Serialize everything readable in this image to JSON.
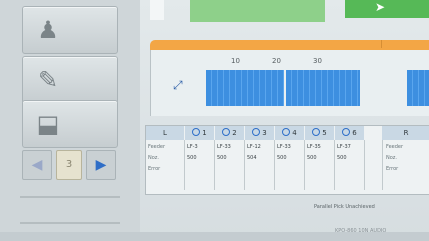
{
  "table": {
    "headers": [
      "L",
      "1",
      "2",
      "3",
      "4",
      "5",
      "6",
      "R"
    ],
    "row_labels": [
      "Feeder",
      "Noz.",
      "Error"
    ],
    "right_row_labels": [
      "Feeder",
      "Noz.",
      "Error"
    ],
    "feeder": [
      "LF-3",
      "LF-33",
      "LF-12",
      "LF-33",
      "LF-35",
      "LF-37"
    ],
    "nozzle": [
      "500",
      "500",
      "504",
      "500",
      "500",
      "500"
    ]
  },
  "scale": {
    "ticks": [
      "10",
      "20",
      "30"
    ]
  },
  "nav": {
    "left_arrow": "◀",
    "right_arrow": "▶",
    "slot": "3"
  },
  "rail": {
    "btn1_glyph": "♟",
    "btn2_glyph": "✎",
    "btn3_glyph": "⬓"
  },
  "ruler_glyph": "⤢",
  "cursor_glyph": "➤",
  "status": "Parallel Pick Unachieved",
  "footer": "KPO-860 10N AUDIO",
  "colors": {
    "orange": "#f3a645",
    "blue_seg": "#3d8fe0",
    "green_light": "#8ed08a",
    "green_dark": "#56b957"
  }
}
